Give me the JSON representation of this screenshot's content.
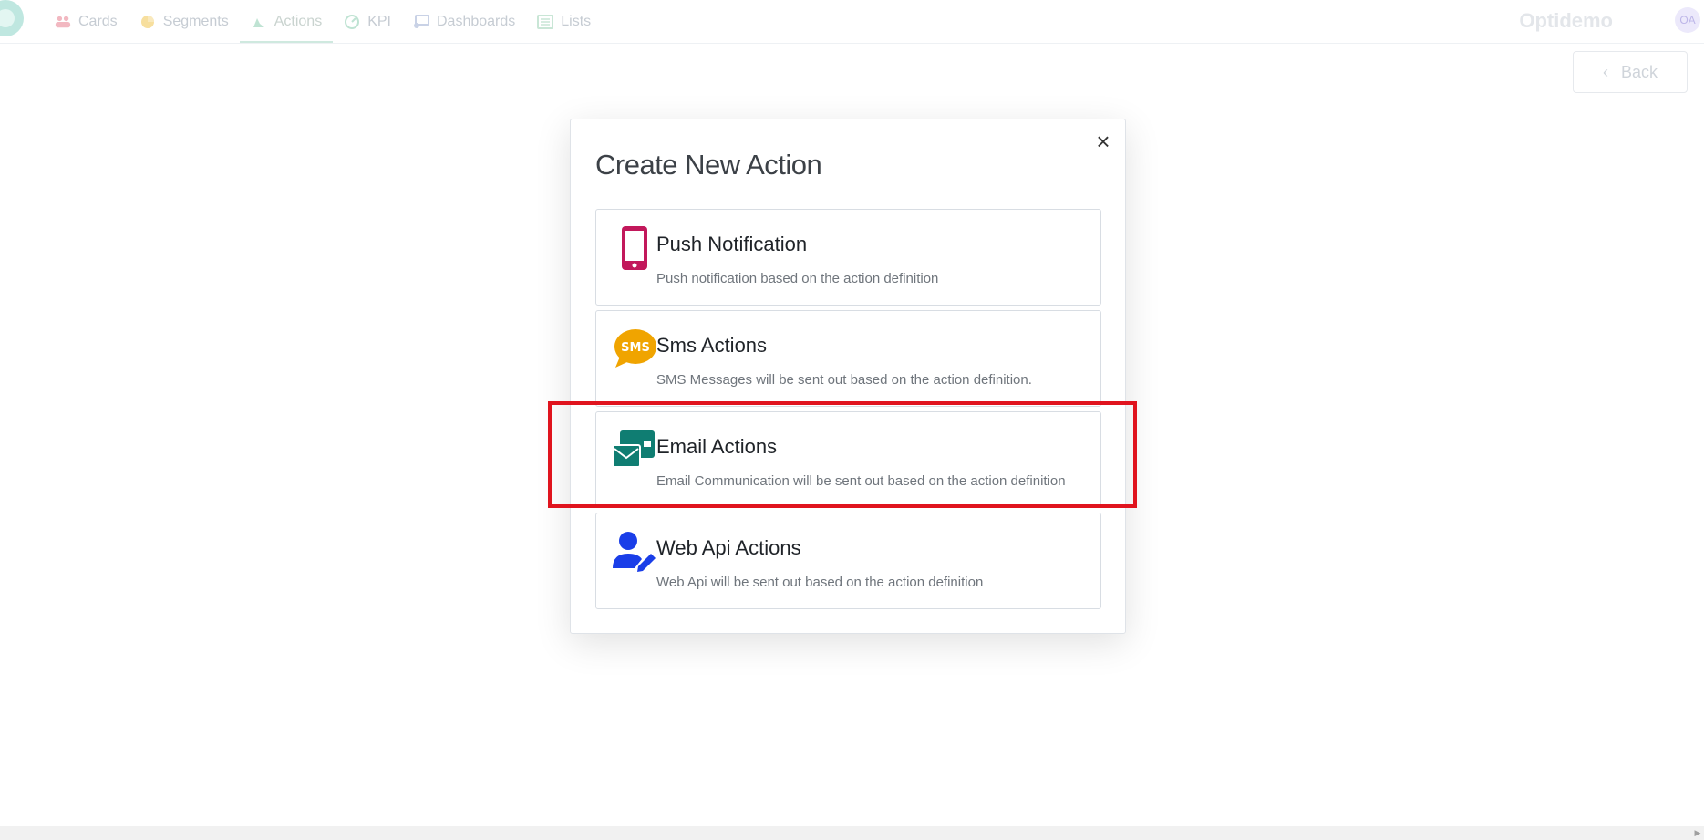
{
  "nav": {
    "items": [
      {
        "label": "Cards",
        "icon": "users-icon",
        "color": "#f2b8c1"
      },
      {
        "label": "Segments",
        "icon": "pie-chart-icon",
        "color": "#f7df9e"
      },
      {
        "label": "Actions",
        "icon": "signal-icon",
        "color": "#bfe3d3"
      },
      {
        "label": "KPI",
        "icon": "gauge-icon",
        "color": "#bfe3d3"
      },
      {
        "label": "Dashboards",
        "icon": "dashboard-icon",
        "color": "#c9d2e6"
      },
      {
        "label": "Lists",
        "icon": "list-icon",
        "color": "#c9e6d6"
      }
    ],
    "active_index": 2,
    "brand": "Optidemo",
    "avatar": "OA"
  },
  "back_button": {
    "label": "Back"
  },
  "modal": {
    "title": "Create New Action",
    "close_icon": "close-icon",
    "cards": [
      {
        "title": "Push Notification",
        "description": "Push notification based on the action definition",
        "icon": "mobile-phone-icon",
        "color": "#c2185b"
      },
      {
        "title": "Sms Actions",
        "description": "SMS Messages will be sent out based on the action definition.",
        "icon": "sms-bubble-icon",
        "icon_text": "SMS",
        "color": "#f0a400"
      },
      {
        "title": "Email Actions",
        "description": "Email Communication will be sent out based on the action definition",
        "icon": "email-envelopes-icon",
        "color": "#0f7d72"
      },
      {
        "title": "Web Api Actions",
        "description": "Web Api will be sent out based on the action definition",
        "icon": "user-edit-icon",
        "color": "#1a3ee8"
      }
    ]
  },
  "highlight_color": "#e0141e"
}
